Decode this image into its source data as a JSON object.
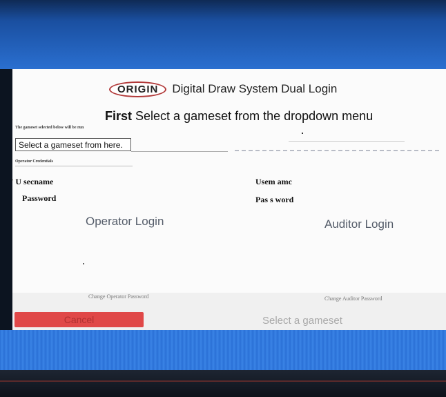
{
  "dialog": {
    "logo_text": "ORIGIN",
    "title": "Digital Draw System Dual Login",
    "subtitle_strong": "First",
    "subtitle_rest": " Select a gameset from the dropdown menu",
    "gameset_hint": "The gameset selected below will be run",
    "gameset_select_value": "Select a gameset from here.",
    "operator_small_label": "Operator Credentials"
  },
  "operator": {
    "username_label": "' U secname",
    "password_label": "Password",
    "login_button": "Operator Login",
    "change_password_link": "Change Operator Password"
  },
  "auditor": {
    "username_label": "Usem amc",
    "password_label": "Pas s word",
    "login_button": "Auditor Login",
    "change_password_link": "Change Auditor Password"
  },
  "footer": {
    "cancel_button": "Cancel",
    "select_gameset_button": "Select a gameset"
  },
  "colors": {
    "cancel": "#e04848",
    "desktop_blue": "#2a70d6",
    "logo_ring": "#b23a3a"
  }
}
